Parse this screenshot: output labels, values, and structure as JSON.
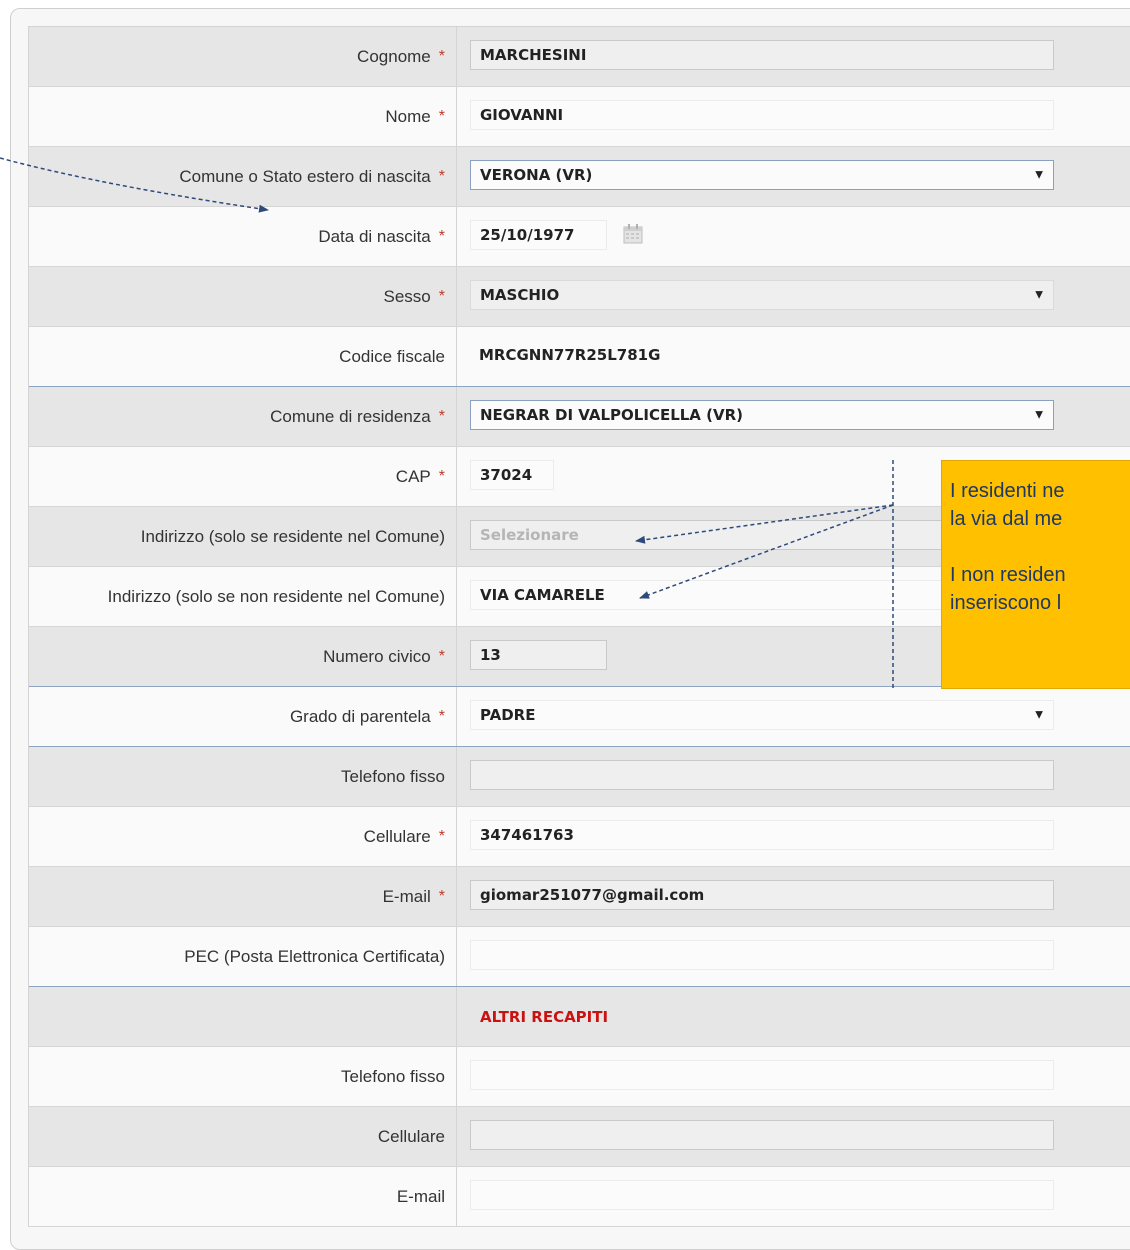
{
  "form": {
    "rows": [
      {
        "label": "Cognome",
        "required": true,
        "value": "MARCHESINI"
      },
      {
        "label": "Nome",
        "required": true,
        "value": "GIOVANNI"
      },
      {
        "label": "Comune o Stato estero di nascita",
        "required": true,
        "value": "VERONA (VR)",
        "type": "select"
      },
      {
        "label": "Data di nascita",
        "required": true,
        "value": "25/10/1977",
        "type": "date"
      },
      {
        "label": "Sesso",
        "required": true,
        "value": "MASCHIO",
        "type": "select"
      },
      {
        "label": "Codice fiscale",
        "required": false,
        "value": "MRCGNN77R25L781G",
        "type": "readonly"
      },
      {
        "label": "Comune di residenza",
        "required": true,
        "value": "NEGRAR DI VALPOLICELLA (VR)",
        "type": "select"
      },
      {
        "label": "CAP",
        "required": true,
        "value": "37024"
      },
      {
        "label": "Indirizzo (solo se residente nel Comune)",
        "required": false,
        "value": "",
        "placeholder": "Selezionare",
        "type": "select"
      },
      {
        "label": "Indirizzo (solo se non residente nel Comune)",
        "required": false,
        "value": "VIA CAMARELE"
      },
      {
        "label": "Numero civico",
        "required": true,
        "value": "13"
      },
      {
        "label": "Grado di parentela",
        "required": true,
        "value": "PADRE",
        "type": "select"
      },
      {
        "label": "Telefono fisso",
        "required": false,
        "value": ""
      },
      {
        "label": "Cellulare",
        "required": true,
        "value": "347461763"
      },
      {
        "label": "E-mail",
        "required": true,
        "value": "giomar251077@gmail.com"
      },
      {
        "label": "PEC (Posta Elettronica Certificata)",
        "required": false,
        "value": ""
      }
    ],
    "required_marker": "*",
    "dropdown_arrow": "▼",
    "section": {
      "title": "ALTRI RECAPITI"
    },
    "other_rows": [
      {
        "label": "Telefono fisso",
        "value": ""
      },
      {
        "label": "Cellulare",
        "value": ""
      },
      {
        "label": "E-mail",
        "value": ""
      }
    ]
  },
  "note": {
    "line1": "I residenti ne",
    "line2": "la via dal me",
    "line3": "I non residen",
    "line4": "inseriscono l"
  },
  "colors": {
    "accent": "#ffc000",
    "arrow": "#2f4a7a",
    "required": "#c0392b",
    "section_title": "#cc1111"
  }
}
